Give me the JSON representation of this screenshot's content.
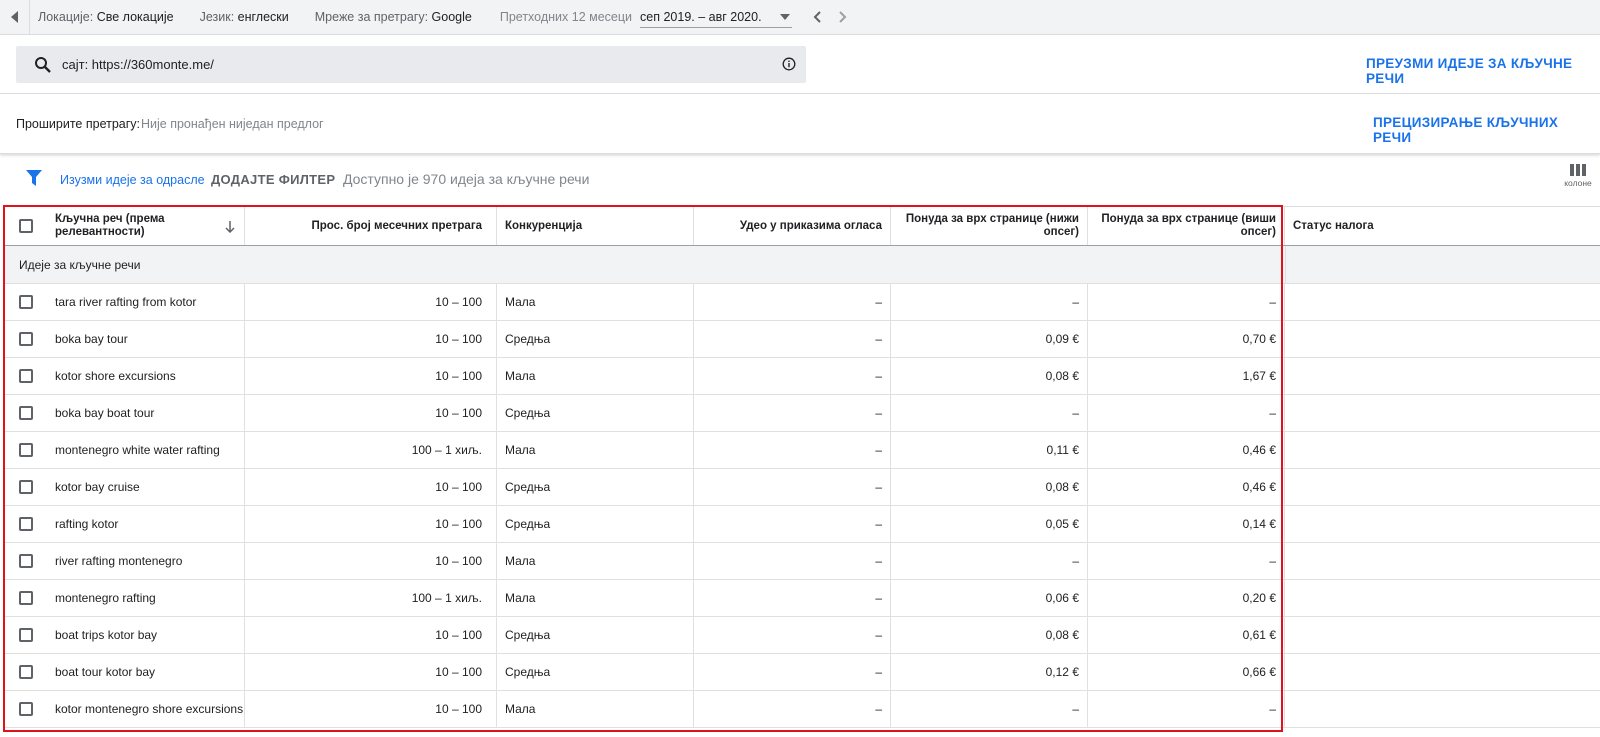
{
  "topbar": {
    "location_key": "Локације:",
    "location_val": "Све локације",
    "language_key": "Језик:",
    "language_val": "енглески",
    "network_key": "Мреже за претрагу:",
    "network_val": "Google",
    "date_label": "Претходних 12 месеци",
    "date_value": "сеп 2019. – авг 2020."
  },
  "search": {
    "value": "сајт: https://360monte.me/",
    "download_label": "ПРЕУЗМИ ИДЕЈЕ ЗА КЉУЧНЕ РЕЧИ"
  },
  "broaden": {
    "label": "Проширите претрагу:",
    "value": "Није пронађен ниједан предлог",
    "refine_label": "ПРЕЦИЗИРАЊЕ КЉУЧНИХ РЕЧИ"
  },
  "filters": {
    "exclude_adult": "Изузми идеје за одрасле",
    "add_filter": "ДОДАЈТЕ ФИЛТЕР",
    "available": "Доступно је 970 идеја за кључне речи",
    "columns_label": "колоне"
  },
  "table": {
    "headers": {
      "keyword": "Кључна реч (према релевантности)",
      "searches": "Прос. број месечних претрага",
      "competition": "Конкуренција",
      "impr_share": "Удео у приказима огласа",
      "bid_low": "Понуда за врх странице (нижи опсег)",
      "bid_high": "Понуда за врх странице (виши опсег)",
      "account_status": "Статус налога"
    },
    "group_label": "Идеје за кључне речи",
    "rows": [
      {
        "keyword": "tara river rafting from kotor",
        "searches": "10 – 100",
        "competition": "Мала",
        "impr_share": "–",
        "bid_low": "–",
        "bid_high": "–"
      },
      {
        "keyword": "boka bay tour",
        "searches": "10 – 100",
        "competition": "Средња",
        "impr_share": "–",
        "bid_low": "0,09 €",
        "bid_high": "0,70 €"
      },
      {
        "keyword": "kotor shore excursions",
        "searches": "10 – 100",
        "competition": "Мала",
        "impr_share": "–",
        "bid_low": "0,08 €",
        "bid_high": "1,67 €"
      },
      {
        "keyword": "boka bay boat tour",
        "searches": "10 – 100",
        "competition": "Средња",
        "impr_share": "–",
        "bid_low": "–",
        "bid_high": "–"
      },
      {
        "keyword": "montenegro white water rafting",
        "searches": "100 – 1 хиљ.",
        "competition": "Мала",
        "impr_share": "–",
        "bid_low": "0,11 €",
        "bid_high": "0,46 €"
      },
      {
        "keyword": "kotor bay cruise",
        "searches": "10 – 100",
        "competition": "Средња",
        "impr_share": "–",
        "bid_low": "0,08 €",
        "bid_high": "0,46 €"
      },
      {
        "keyword": "rafting kotor",
        "searches": "10 – 100",
        "competition": "Средња",
        "impr_share": "–",
        "bid_low": "0,05 €",
        "bid_high": "0,14 €"
      },
      {
        "keyword": "river rafting montenegro",
        "searches": "10 – 100",
        "competition": "Мала",
        "impr_share": "–",
        "bid_low": "–",
        "bid_high": "–"
      },
      {
        "keyword": "montenegro rafting",
        "searches": "100 – 1 хиљ.",
        "competition": "Мала",
        "impr_share": "–",
        "bid_low": "0,06 €",
        "bid_high": "0,20 €"
      },
      {
        "keyword": "boat trips kotor bay",
        "searches": "10 – 100",
        "competition": "Средња",
        "impr_share": "–",
        "bid_low": "0,08 €",
        "bid_high": "0,61 €"
      },
      {
        "keyword": "boat tour kotor bay",
        "searches": "10 – 100",
        "competition": "Средња",
        "impr_share": "–",
        "bid_low": "0,12 €",
        "bid_high": "0,66 €"
      },
      {
        "keyword": "kotor montenegro shore excursions",
        "searches": "10 – 100",
        "competition": "Мала",
        "impr_share": "–",
        "bid_low": "–",
        "bid_high": "–"
      }
    ]
  },
  "colors": {
    "accent": "#1a73e8",
    "highlight_border": "#e0121b"
  }
}
